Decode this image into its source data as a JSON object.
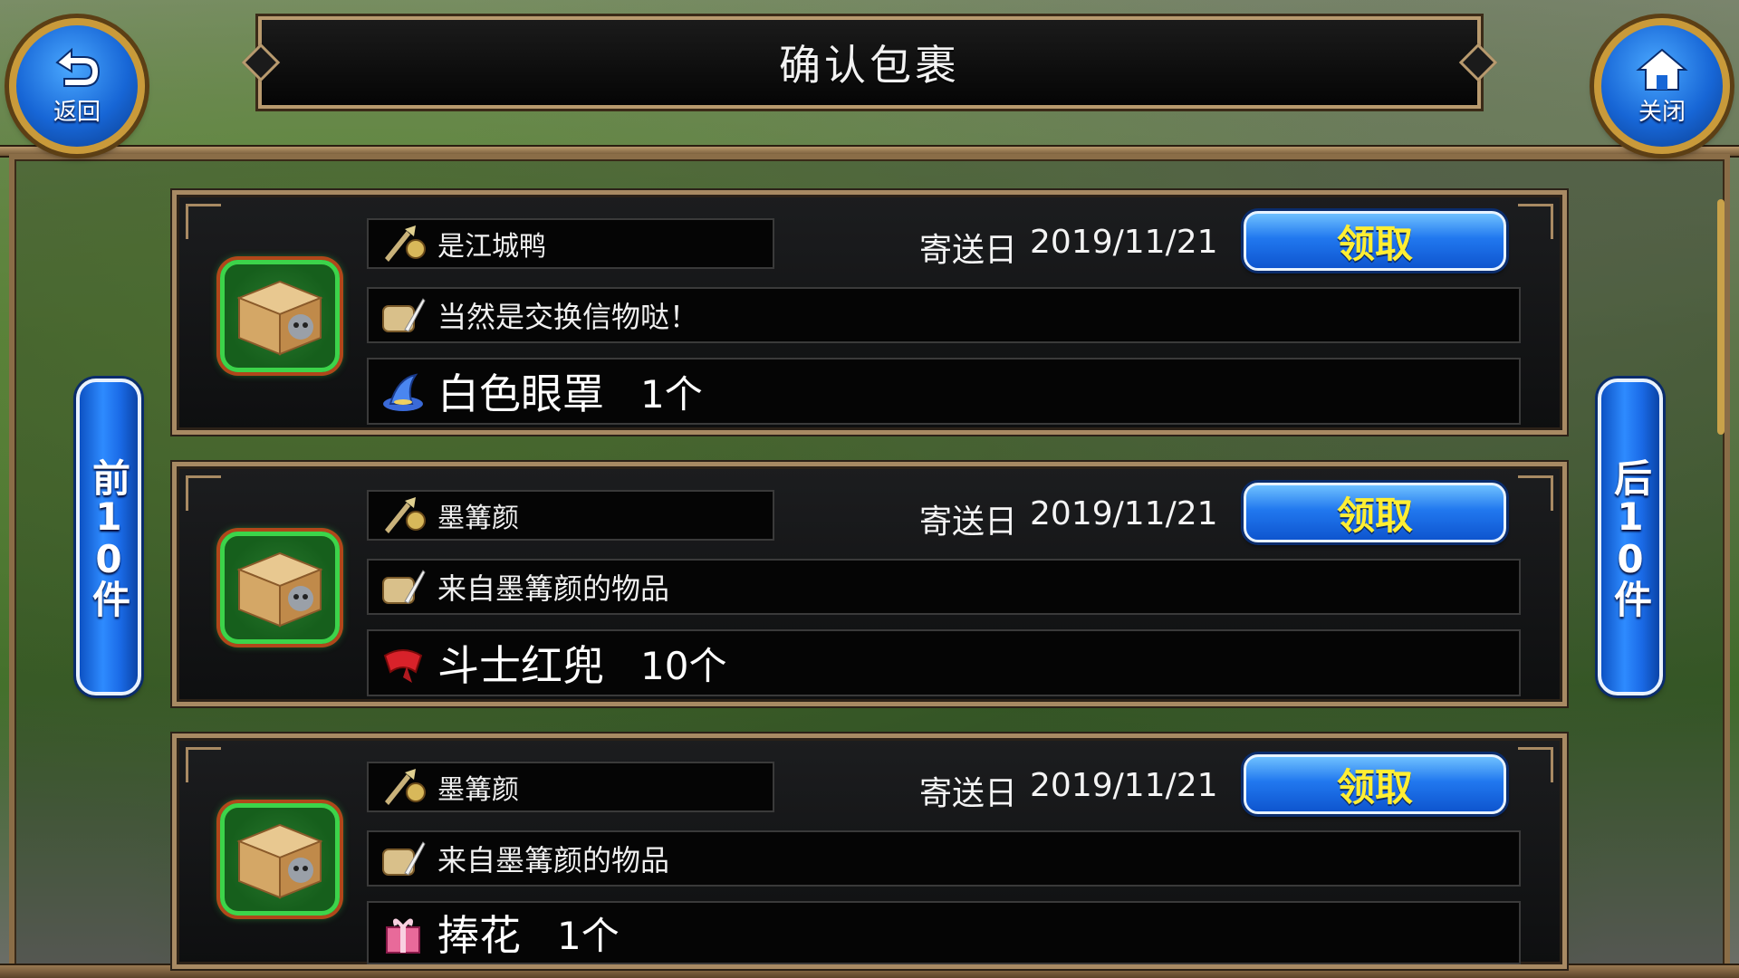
{
  "header": {
    "title": "确认包裹",
    "back_label": "返回",
    "close_label": "关闭"
  },
  "pagination": {
    "prev_label": "前10件",
    "next_label": "后10件"
  },
  "mails": [
    {
      "sender": "是江城鸭",
      "date_label": "寄送日",
      "date": "2019/11/21",
      "claim_label": "领取",
      "message": "当然是交换信物哒！",
      "item_name": "白色眼罩",
      "item_qty": "1个",
      "item_icon": "blue-hat-icon"
    },
    {
      "sender": "墨篝颜",
      "date_label": "寄送日",
      "date": "2019/11/21",
      "claim_label": "领取",
      "message": "来自墨篝颜的物品",
      "item_name": "斗士红兜",
      "item_qty": "10个",
      "item_icon": "red-scarf-icon"
    },
    {
      "sender": "墨篝颜",
      "date_label": "寄送日",
      "date": "2019/11/21",
      "claim_label": "领取",
      "message": "来自墨篝颜的物品",
      "item_name": "捧花",
      "item_qty": "1个",
      "item_icon": "gift-box-icon"
    }
  ],
  "colors": {
    "button_blue": "#2178ef",
    "claim_text": "#ffee33",
    "frame_gold": "#a88a63",
    "box_glow": "#3cd44a"
  }
}
